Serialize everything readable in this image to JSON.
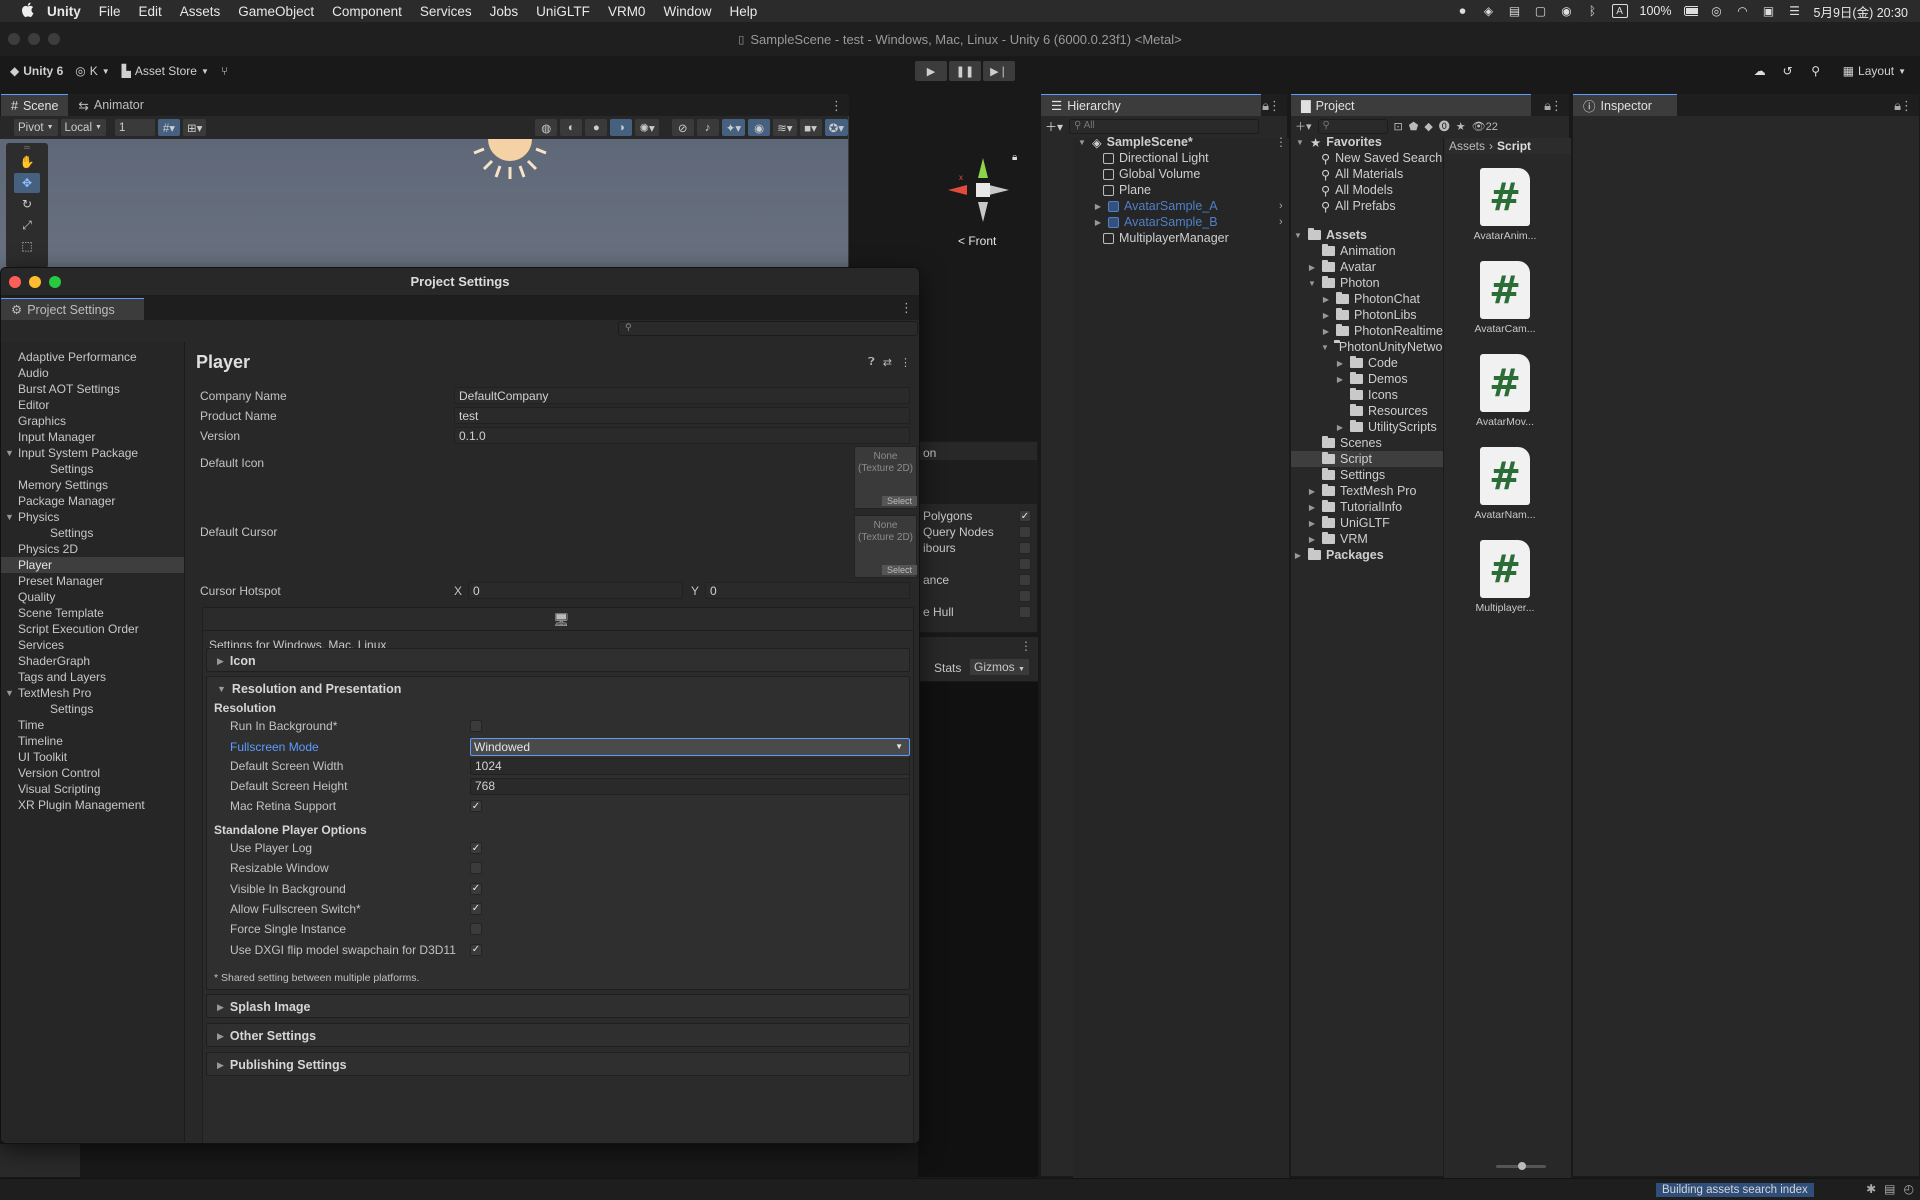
{
  "menubar": {
    "app_name": "Unity",
    "items": [
      "File",
      "Edit",
      "Assets",
      "GameObject",
      "Component",
      "Services",
      "Jobs",
      "UniGLTF",
      "VRM0",
      "Window",
      "Help"
    ],
    "battery": "100%",
    "datetime": "5月9日(金) 20:30",
    "input_indicator": "A"
  },
  "window": {
    "title": "SampleScene - test - Windows, Mac, Linux - Unity 6 (6000.0.23f1) <Metal>"
  },
  "toolbar": {
    "unity_label": "Unity 6",
    "account_label": "K",
    "asset_store_label": "Asset Store",
    "layout_label": "Layout"
  },
  "scene": {
    "tabs": [
      "Scene",
      "Animator"
    ],
    "pivot_label": "Pivot",
    "local_label": "Local",
    "grid_snap_value": "1",
    "gizmo_front_label": "< Front",
    "stats_label": "Stats",
    "gizmos_label": "Gizmos",
    "nav_overlay": {
      "title_fragment": "on",
      "rows": [
        {
          "label": "Polygons",
          "checked": true
        },
        {
          "label": "Query Nodes",
          "checked": false
        },
        {
          "label": "ibours",
          "checked": false
        },
        {
          "label": "",
          "checked": false
        },
        {
          "label": "ance",
          "checked": false
        },
        {
          "label": "",
          "checked": false
        },
        {
          "label": "e Hull",
          "checked": false
        }
      ]
    }
  },
  "project_settings": {
    "window_title": "Project Settings",
    "tab_label": "Project Settings",
    "categories": [
      {
        "label": "Adaptive Performance",
        "level": 0
      },
      {
        "label": "Audio",
        "level": 0
      },
      {
        "label": "Burst AOT Settings",
        "level": 0
      },
      {
        "label": "Editor",
        "level": 0
      },
      {
        "label": "Graphics",
        "level": 0
      },
      {
        "label": "Input Manager",
        "level": 0
      },
      {
        "label": "Input System Package",
        "level": 0,
        "expanded": true
      },
      {
        "label": "Settings",
        "level": 1
      },
      {
        "label": "Memory Settings",
        "level": 0
      },
      {
        "label": "Package Manager",
        "level": 0
      },
      {
        "label": "Physics",
        "level": 0,
        "expanded": true
      },
      {
        "label": "Settings",
        "level": 1
      },
      {
        "label": "Physics 2D",
        "level": 0
      },
      {
        "label": "Player",
        "level": 0,
        "selected": true
      },
      {
        "label": "Preset Manager",
        "level": 0
      },
      {
        "label": "Quality",
        "level": 0
      },
      {
        "label": "Scene Template",
        "level": 0
      },
      {
        "label": "Script Execution Order",
        "level": 0
      },
      {
        "label": "Services",
        "level": 0
      },
      {
        "label": "ShaderGraph",
        "level": 0
      },
      {
        "label": "Tags and Layers",
        "level": 0
      },
      {
        "label": "TextMesh Pro",
        "level": 0,
        "expanded": true
      },
      {
        "label": "Settings",
        "level": 1
      },
      {
        "label": "Time",
        "level": 0
      },
      {
        "label": "Timeline",
        "level": 0
      },
      {
        "label": "UI Toolkit",
        "level": 0
      },
      {
        "label": "Version Control",
        "level": 0
      },
      {
        "label": "Visual Scripting",
        "level": 0
      },
      {
        "label": "XR Plugin Management",
        "level": 0
      }
    ],
    "player": {
      "title": "Player",
      "company_name_label": "Company Name",
      "company_name": "DefaultCompany",
      "product_name_label": "Product Name",
      "product_name": "test",
      "version_label": "Version",
      "version": "0.1.0",
      "default_icon_label": "Default Icon",
      "default_cursor_label": "Default Cursor",
      "texture_none": "None\n(Texture 2D)",
      "texture_select": "Select",
      "cursor_hotspot_label": "Cursor Hotspot",
      "hotspot_x_label": "X",
      "hotspot_x": "0",
      "hotspot_y_label": "Y",
      "hotspot_y": "0",
      "platform_label": "Settings for Windows, Mac, Linux",
      "icon_section": "Icon",
      "resolution_section": "Resolution and Presentation",
      "resolution_heading": "Resolution",
      "run_in_background_label": "Run In Background*",
      "run_in_background": false,
      "fullscreen_mode_label": "Fullscreen Mode",
      "fullscreen_mode": "Windowed",
      "default_width_label": "Default Screen Width",
      "default_width": "1024",
      "default_height_label": "Default Screen Height",
      "default_height": "768",
      "mac_retina_label": "Mac Retina Support",
      "mac_retina": true,
      "standalone_heading": "Standalone Player Options",
      "standalone_options": [
        {
          "label": "Use Player Log",
          "checked": true
        },
        {
          "label": "Resizable Window",
          "checked": false
        },
        {
          "label": "Visible In Background",
          "checked": true
        },
        {
          "label": "Allow Fullscreen Switch*",
          "checked": true
        },
        {
          "label": "Force Single Instance",
          "checked": false
        },
        {
          "label": "Use DXGI flip model swapchain for D3D11",
          "checked": true
        }
      ],
      "shared_note": "* Shared setting between multiple platforms.",
      "splash_section": "Splash Image",
      "other_section": "Other Settings",
      "publishing_section": "Publishing Settings"
    }
  },
  "hierarchy": {
    "tab_label": "Hierarchy",
    "search_placeholder": "All",
    "scene_name": "SampleScene*",
    "items": [
      {
        "label": "Directional Light",
        "prefab": false
      },
      {
        "label": "Global Volume",
        "prefab": false
      },
      {
        "label": "Plane",
        "prefab": false
      },
      {
        "label": "AvatarSample_A",
        "prefab": true
      },
      {
        "label": "AvatarSample_B",
        "prefab": true
      },
      {
        "label": "MultiplayerManager",
        "prefab": false
      }
    ]
  },
  "project": {
    "tab_label": "Project",
    "hidden_count": "22",
    "breadcrumb": [
      "Assets",
      "Script"
    ],
    "favorites_label": "Favorites",
    "favorites": [
      "New Saved Search",
      "All Materials",
      "All Models",
      "All Prefabs"
    ],
    "tree": [
      {
        "label": "Assets",
        "depth": 0,
        "bold": true,
        "open": true
      },
      {
        "label": "Animation",
        "depth": 1
      },
      {
        "label": "Avatar",
        "depth": 1,
        "arrow": true
      },
      {
        "label": "Photon",
        "depth": 1,
        "open": true
      },
      {
        "label": "PhotonChat",
        "depth": 2,
        "arrow": true
      },
      {
        "label": "PhotonLibs",
        "depth": 2,
        "arrow": true
      },
      {
        "label": "PhotonRealtime",
        "depth": 2,
        "arrow": true
      },
      {
        "label": "PhotonUnityNetworking",
        "depth": 2,
        "open": true
      },
      {
        "label": "Code",
        "depth": 3,
        "arrow": true
      },
      {
        "label": "Demos",
        "depth": 3,
        "arrow": true
      },
      {
        "label": "Icons",
        "depth": 3
      },
      {
        "label": "Resources",
        "depth": 3
      },
      {
        "label": "UtilityScripts",
        "depth": 3,
        "arrow": true
      },
      {
        "label": "Scenes",
        "depth": 1
      },
      {
        "label": "Script",
        "depth": 1,
        "selected": true
      },
      {
        "label": "Settings",
        "depth": 1
      },
      {
        "label": "TextMesh Pro",
        "depth": 1,
        "arrow": true
      },
      {
        "label": "TutorialInfo",
        "depth": 1,
        "arrow": true
      },
      {
        "label": "UniGLTF",
        "depth": 1,
        "arrow": true
      },
      {
        "label": "VRM",
        "depth": 1,
        "arrow": true
      },
      {
        "label": "Packages",
        "depth": 0,
        "bold": true,
        "arrow": true
      }
    ],
    "assets": [
      "AvatarAnim...",
      "AvatarCam...",
      "AvatarMov...",
      "AvatarNam...",
      "Multiplayer..."
    ],
    "asset_glyph": "#"
  },
  "inspector": {
    "tab_label": "Inspector"
  },
  "status": {
    "message": "Building assets search index"
  }
}
